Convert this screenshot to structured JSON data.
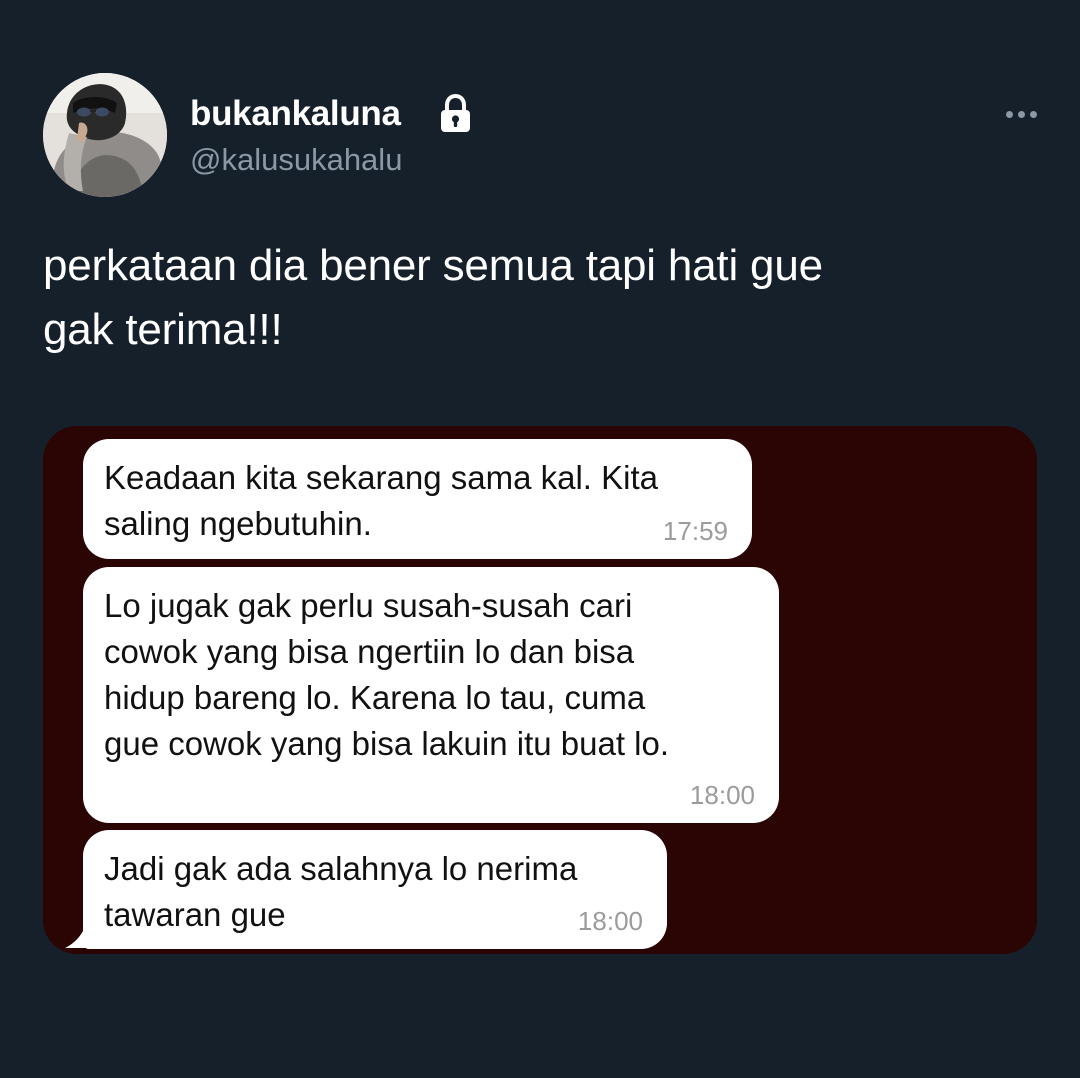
{
  "author": {
    "display_name": "bukankaluna",
    "handle": "@kalusukahalu",
    "avatar_icon": "profile-photo",
    "protected_icon": "lock-icon"
  },
  "tweet": {
    "text": "perkataan dia bener semua tapi hati gue\ngak terima!!!"
  },
  "more_icon": "more-horizontal-icon",
  "media": {
    "background_color": "#2b0404",
    "messages": [
      {
        "text": "Keadaan kita sekarang sama kal. Kita\nsaling ngebutuhin.",
        "time": "17:59"
      },
      {
        "text": "Lo jugak gak perlu susah-susah cari\ncowok yang bisa ngertiin lo dan bisa\nhidup bareng lo. Karena lo tau, cuma\ngue cowok yang bisa lakuin itu buat lo.",
        "time": "18:00"
      },
      {
        "text": "Jadi gak ada salahnya lo nerima\ntawaran gue",
        "time": "18:00"
      }
    ]
  },
  "colors": {
    "background": "#15202b",
    "secondary_text": "#8b98a5",
    "bubble": "#ffffff"
  }
}
